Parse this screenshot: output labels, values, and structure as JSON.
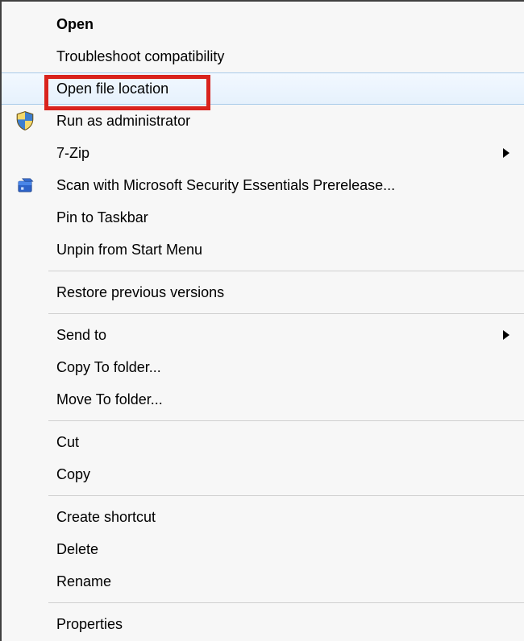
{
  "menu": {
    "items": [
      {
        "id": "open",
        "label": "Open",
        "bold": true
      },
      {
        "id": "troubleshoot",
        "label": "Troubleshoot compatibility"
      },
      {
        "id": "openloc",
        "label": "Open file location",
        "hover": true
      },
      {
        "id": "runadmin",
        "label": "Run as administrator",
        "icon": "shield"
      },
      {
        "id": "7zip",
        "label": "7-Zip",
        "submenu": true
      },
      {
        "id": "scan",
        "label": "Scan with Microsoft Security Essentials Prerelease...",
        "icon": "security"
      },
      {
        "id": "pintb",
        "label": "Pin to Taskbar"
      },
      {
        "id": "unpinsm",
        "label": "Unpin from Start Menu"
      },
      {
        "sep": true
      },
      {
        "id": "restorepv",
        "label": "Restore previous versions"
      },
      {
        "sep": true
      },
      {
        "id": "sendto",
        "label": "Send to",
        "submenu": true
      },
      {
        "id": "copyto",
        "label": "Copy To folder..."
      },
      {
        "id": "moveto",
        "label": "Move To folder..."
      },
      {
        "sep": true
      },
      {
        "id": "cut",
        "label": "Cut"
      },
      {
        "id": "copy",
        "label": "Copy"
      },
      {
        "sep": true
      },
      {
        "id": "shortcut",
        "label": "Create shortcut"
      },
      {
        "id": "delete",
        "label": "Delete"
      },
      {
        "id": "rename",
        "label": "Rename"
      },
      {
        "sep": true
      },
      {
        "id": "properties",
        "label": "Properties"
      }
    ]
  },
  "annotation": {
    "highlight_target": "openloc"
  }
}
